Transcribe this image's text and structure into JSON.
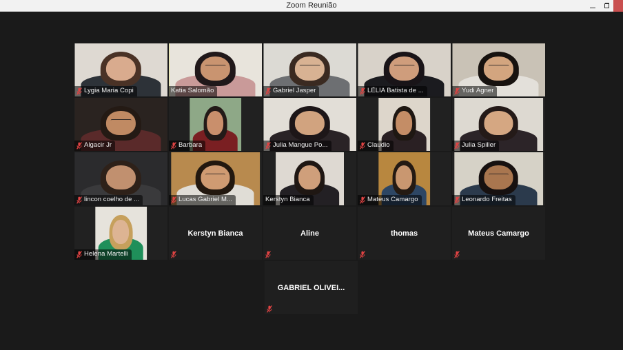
{
  "window": {
    "title": "Zoom Reunião",
    "controls": {
      "minimize": "minimize-button",
      "maximize": "maximize-button",
      "close": "close-button"
    }
  },
  "theme": {
    "background": "#1a1a1a",
    "tile_background": "#212121",
    "titlebar_background": "#f2f2f2",
    "active_speaker_border": "#e8e85a",
    "mute_icon_color": "#e04343",
    "close_button": "#c94f4f",
    "name_text": "#f2f2f2"
  },
  "gallery": {
    "columns": 5,
    "rows": [
      {
        "tiles": [
          {
            "name": "Lygia Maria Copi",
            "video": true,
            "muted": true,
            "active_speaker": false,
            "fit": "full",
            "skin": "#d9ab8e",
            "hair": "#4a3226",
            "shirt": "#2d3238",
            "bg": "#ded9d2",
            "glasses": false
          },
          {
            "name": "Katia Salomão",
            "video": true,
            "muted": false,
            "active_speaker": true,
            "fit": "full",
            "skin": "#c99470",
            "hair": "#20181a",
            "shirt": "#c99a99",
            "bg": "#e8e4dc",
            "glasses": true
          },
          {
            "name": "Gabriel Jasper",
            "video": true,
            "muted": true,
            "active_speaker": false,
            "fit": "full",
            "skin": "#d8b293",
            "hair": "#3a2a21",
            "shirt": "#6d6f72",
            "bg": "#dcdad4",
            "glasses": true
          },
          {
            "name": "LÉLIA Batista de ...",
            "video": true,
            "muted": true,
            "active_speaker": false,
            "fit": "full",
            "skin": "#cf9d7c",
            "hair": "#191418",
            "shirt": "#1b1b1f",
            "bg": "#d8d2c9",
            "glasses": true
          },
          {
            "name": "Yudi Agner",
            "video": true,
            "muted": true,
            "active_speaker": false,
            "fit": "full",
            "skin": "#d3a57f",
            "hair": "#17120f",
            "shirt": "#e3e0da",
            "bg": "#c9c2b6",
            "glasses": true
          }
        ]
      },
      {
        "tiles": [
          {
            "name": "Algacir Jr",
            "video": true,
            "muted": true,
            "active_speaker": false,
            "fit": "full",
            "skin": "#c08a63",
            "hair": "#241a14",
            "shirt": "#5a2a2a",
            "bg": "#2a2320",
            "glasses": true
          },
          {
            "name": "Barbara",
            "video": true,
            "muted": true,
            "active_speaker": false,
            "fit": "narrow",
            "skin": "#c98f6c",
            "hair": "#231a18",
            "shirt": "#7a1f22",
            "bg": "#8ea887",
            "glasses": false
          },
          {
            "name": "Julia Mangue Po...",
            "video": true,
            "muted": true,
            "active_speaker": false,
            "fit": "full",
            "skin": "#d1a37f",
            "hair": "#1d1618",
            "shirt": "#2a2326",
            "bg": "#e2ded7",
            "glasses": false
          },
          {
            "name": "Claudio",
            "video": true,
            "muted": true,
            "active_speaker": false,
            "fit": "narrow",
            "skin": "#c48d66",
            "hair": "#1e1712",
            "shirt": "#2a2023",
            "bg": "#ddd6cb",
            "glasses": false
          },
          {
            "name": "Julia Spiller",
            "video": true,
            "muted": true,
            "active_speaker": false,
            "fit": "wide",
            "skin": "#d5a782",
            "hair": "#241a18",
            "shirt": "#2c2428",
            "bg": "#ddd9d1",
            "glasses": false
          }
        ]
      },
      {
        "tiles": [
          {
            "name": "lincon coelho de ...",
            "video": true,
            "muted": true,
            "active_speaker": false,
            "fit": "full",
            "skin": "#c1906f",
            "hair": "#2e2119",
            "shirt": "#3a3a3c",
            "bg": "#2b2b2d",
            "glasses": false
          },
          {
            "name": "Lucas Gabriel M...",
            "video": true,
            "muted": true,
            "active_speaker": false,
            "fit": "wide",
            "skin": "#cf9b72",
            "hair": "#22180f",
            "shirt": "#e0ddd6",
            "bg": "#b88a4e",
            "glasses": true
          },
          {
            "name": "Kerstyn Bianca",
            "video": true,
            "muted": false,
            "active_speaker": false,
            "fit": "mid",
            "skin": "#cf9f7b",
            "hair": "#1f1713",
            "shirt": "#232024",
            "bg": "#ded9d2",
            "glasses": false
          },
          {
            "name": "Mateus Camargo",
            "video": true,
            "muted": true,
            "active_speaker": false,
            "fit": "narrow",
            "skin": "#c99770",
            "hair": "#241a13",
            "shirt": "#2d4664",
            "bg": "#b8873f",
            "glasses": false
          },
          {
            "name": "Leonardo Freitas",
            "video": true,
            "muted": true,
            "active_speaker": false,
            "fit": "wide",
            "skin": "#a9764f",
            "hair": "#171110",
            "shirt": "#2b3a4c",
            "bg": "#d6d2c7",
            "glasses": true
          }
        ]
      },
      {
        "tiles": [
          {
            "name": "Helena Martelli",
            "video": true,
            "muted": true,
            "active_speaker": false,
            "fit": "narrow",
            "skin": "#ddb493",
            "hair": "#c6a05c",
            "shirt": "#1f8f5a",
            "bg": "#e6e3dc",
            "glasses": false
          },
          {
            "name": "Kerstyn Bianca",
            "video": false,
            "muted": true,
            "active_speaker": false
          },
          {
            "name": "Aline",
            "video": false,
            "muted": true,
            "active_speaker": false
          },
          {
            "name": "thomas",
            "video": false,
            "muted": true,
            "active_speaker": false
          },
          {
            "name": "Mateus Camargo",
            "video": false,
            "muted": true,
            "active_speaker": false
          }
        ]
      },
      {
        "tiles": [
          {
            "name": "GABRIEL OLIVEI...",
            "video": false,
            "muted": true,
            "active_speaker": false
          }
        ]
      }
    ]
  }
}
